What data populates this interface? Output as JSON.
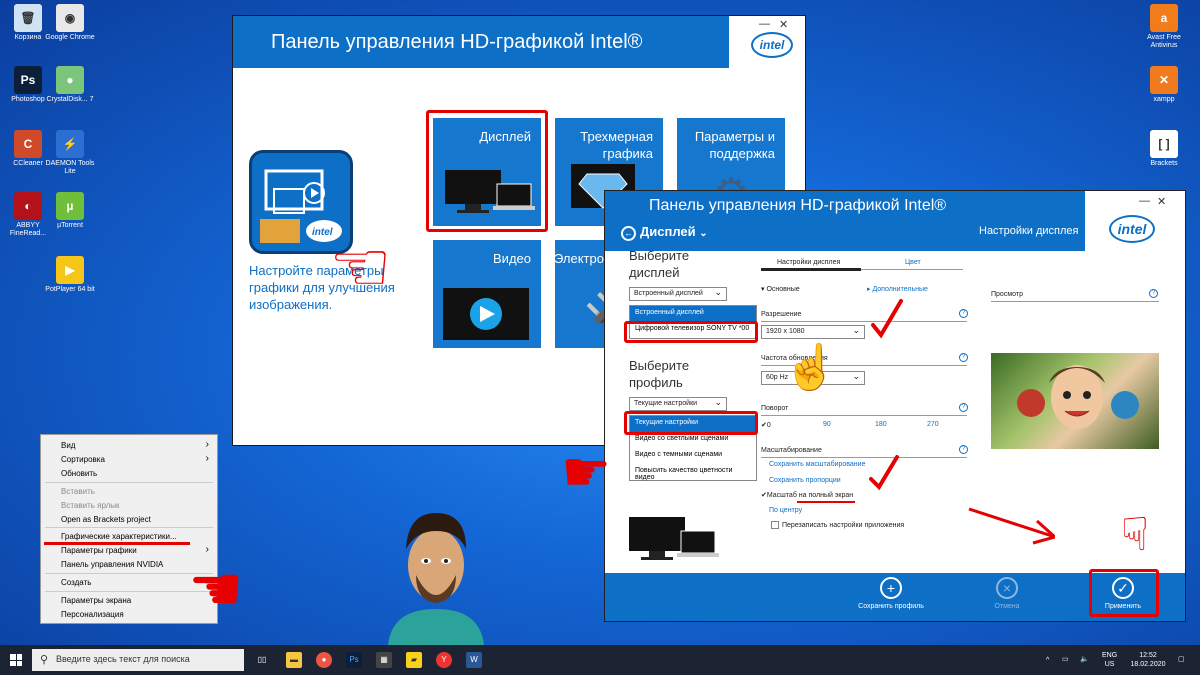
{
  "desktop": {
    "icons_left": [
      {
        "label": "Корзина",
        "glyph": "🗑",
        "color": "#cfe3f5"
      },
      {
        "label": "Google Chrome",
        "glyph": "◉",
        "color": "#e8e8e8"
      },
      {
        "label": "Photoshop",
        "glyph": "Ps",
        "color": "#0b1f3a"
      },
      {
        "label": "CrystalDisk... 7",
        "glyph": "●",
        "color": "#7bc67b"
      },
      {
        "label": "CCleaner",
        "glyph": "C",
        "color": "#d04a2a"
      },
      {
        "label": "DAEMON Tools Lite",
        "glyph": "⚡",
        "color": "#2b6fd1"
      },
      {
        "label": "ABBYY FineRead...",
        "glyph": "◐",
        "color": "#b3121a"
      },
      {
        "label": "µTorrent",
        "glyph": "µ",
        "color": "#6fbf3a"
      },
      {
        "label": "PotPlayer 64 bit",
        "glyph": "▶",
        "color": "#f5c518"
      }
    ],
    "icons_right": [
      {
        "label": "Avast Free Antivirus",
        "glyph": "a",
        "color": "#f07c1a"
      },
      {
        "label": "xampp",
        "glyph": "✕",
        "color": "#f27a1e"
      },
      {
        "label": "Brackets",
        "glyph": "[ ]",
        "color": "#ffffff"
      }
    ]
  },
  "window_main": {
    "title": "Панель управления HD-графикой Intel®",
    "logo": "intel",
    "description": "Настройте параметры графики для улучшения изображения.",
    "tiles": [
      {
        "label": "Дисплей",
        "glyph": "🖥"
      },
      {
        "label": "Трехмерная графика",
        "glyph": "💎"
      },
      {
        "label": "Параметры и поддержка",
        "glyph": "⚙"
      },
      {
        "label": "Видео",
        "glyph": "▶"
      },
      {
        "label": "Электропитание",
        "glyph": "🔌"
      }
    ]
  },
  "context_menu": {
    "items": [
      {
        "label": "Вид",
        "arrow": "›"
      },
      {
        "label": "Сортировка",
        "arrow": "›"
      },
      {
        "label": "Обновить"
      },
      {
        "label": "Вставить"
      },
      {
        "label": "Вставить ярлык"
      },
      {
        "label": "Open as Brackets project"
      },
      {
        "label": "Графические характеристики..."
      },
      {
        "label": "Параметры графики",
        "arrow": "›"
      },
      {
        "label": "Панель управления NVIDIA"
      },
      {
        "label": "Создать",
        "arrow": "›"
      },
      {
        "label": "Параметры экрана"
      },
      {
        "label": "Персонализация"
      }
    ]
  },
  "window_display": {
    "title": "Панель управления HD-графикой Intel®",
    "nav_label": "Дисплей",
    "breadcrumb": "Настройки дисплея",
    "logo": "intel",
    "select_display_heading": "Выберите дисплей",
    "display_dropdown": "Встроенный дисплей",
    "display_options": [
      "Встроенный дисплей",
      "Цифровой телевизор SONY TV *00"
    ],
    "select_profile_heading": "Выберите профиль",
    "profile_dropdown": "Текущие настройки",
    "profile_options": [
      "Текущие настройки",
      "Видео со светлыми сценами",
      "Видео с темными сценами",
      "Повысить качество цветности видео"
    ],
    "tabs": [
      "Настройки дисплея",
      "Цвет"
    ],
    "basic_label": "Основные",
    "advanced_label": "Дополнительные",
    "preview_label": "Просмотр",
    "resolution_label": "Разрешение",
    "resolution_value": "1920 x 1080",
    "refresh_label": "Частота обновления",
    "refresh_value": "60p Hz",
    "rotation_label": "Поворот",
    "rotation_options": [
      "0",
      "90",
      "180",
      "270"
    ],
    "scaling_label": "Масштабирование",
    "scaling_options": [
      "Сохранить масштабирование",
      "Сохранить пропорции",
      "Масштаб на полный экран",
      "По центру"
    ],
    "override_label": "Перезаписать настройки приложения",
    "help_glyph": "?",
    "buttons": {
      "save_profile": "Сохранить профиль",
      "cancel": "Отмена",
      "apply": "Применить"
    }
  },
  "taskbar": {
    "search_placeholder": "Введите здесь текст для поиска",
    "language": "ENG",
    "region": "US",
    "time": "12:52",
    "date": "18.02.2020"
  },
  "colors": {
    "accent": "#0d6fc6",
    "highlight": "#e60000"
  }
}
